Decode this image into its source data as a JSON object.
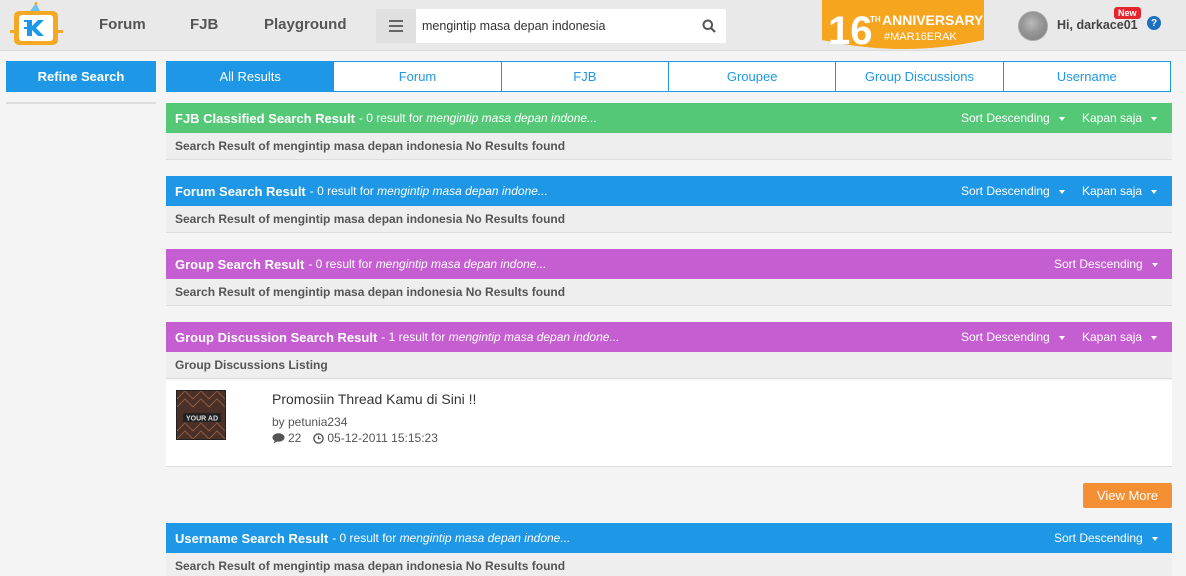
{
  "header": {
    "nav": [
      "Forum",
      "FJB",
      "Playground"
    ],
    "search_value": "mengintip masa depan indonesia",
    "anniversary": {
      "number": "16",
      "suffix": "TH",
      "line1": "ANNIVERSARY",
      "line2": "#MAR16ERAK"
    },
    "user_greeting": "Hi, darkace01",
    "new_badge": "New",
    "help": "?"
  },
  "sidebar": {
    "refine_label": "Refine Search"
  },
  "tabs": [
    "All Results",
    "Forum",
    "FJB",
    "Groupee",
    "Group Discussions",
    "Username"
  ],
  "sections": {
    "fjb": {
      "title": "FJB Classified Search Result",
      "summary": "- 0 result for",
      "query": "mengintip masa depan indone...",
      "sort": "Sort Descending",
      "time": "Kapan saja",
      "body": "Search Result of mengintip masa depan indonesia No Results found"
    },
    "forum": {
      "title": "Forum Search Result",
      "summary": "- 0 result for",
      "query": "mengintip masa depan indone...",
      "sort": "Sort Descending",
      "time": "Kapan saja",
      "body": "Search Result of mengintip masa depan indonesia No Results found"
    },
    "group": {
      "title": "Group Search Result",
      "summary": "- 0 result for",
      "query": "mengintip masa depan indone...",
      "sort": "Sort Descending",
      "body": "Search Result of mengintip masa depan indonesia No Results found"
    },
    "discussion": {
      "title": "Group Discussion Search Result",
      "summary": "- 1 result for",
      "query": "mengintip masa depan indone...",
      "sort": "Sort Descending",
      "time": "Kapan saja",
      "body": "Group Discussions Listing"
    },
    "username": {
      "title": "Username Search Result",
      "summary": "- 0 result for",
      "query": "mengintip masa depan indone...",
      "sort": "Sort Descending",
      "body": "Search Result of mengintip masa depan indonesia No Results found"
    }
  },
  "thread": {
    "title": "Promosiin Thread Kamu di Sini !!",
    "by": "by petunia234",
    "comments": "22",
    "date": "05-12-2011 15:15:23",
    "thumb_text": "YOUR AD"
  },
  "view_more": "View More",
  "colors": {
    "blue": "#1e98e6",
    "green": "#55c878",
    "purple": "#c45ed1",
    "orange": "#f58f33"
  }
}
